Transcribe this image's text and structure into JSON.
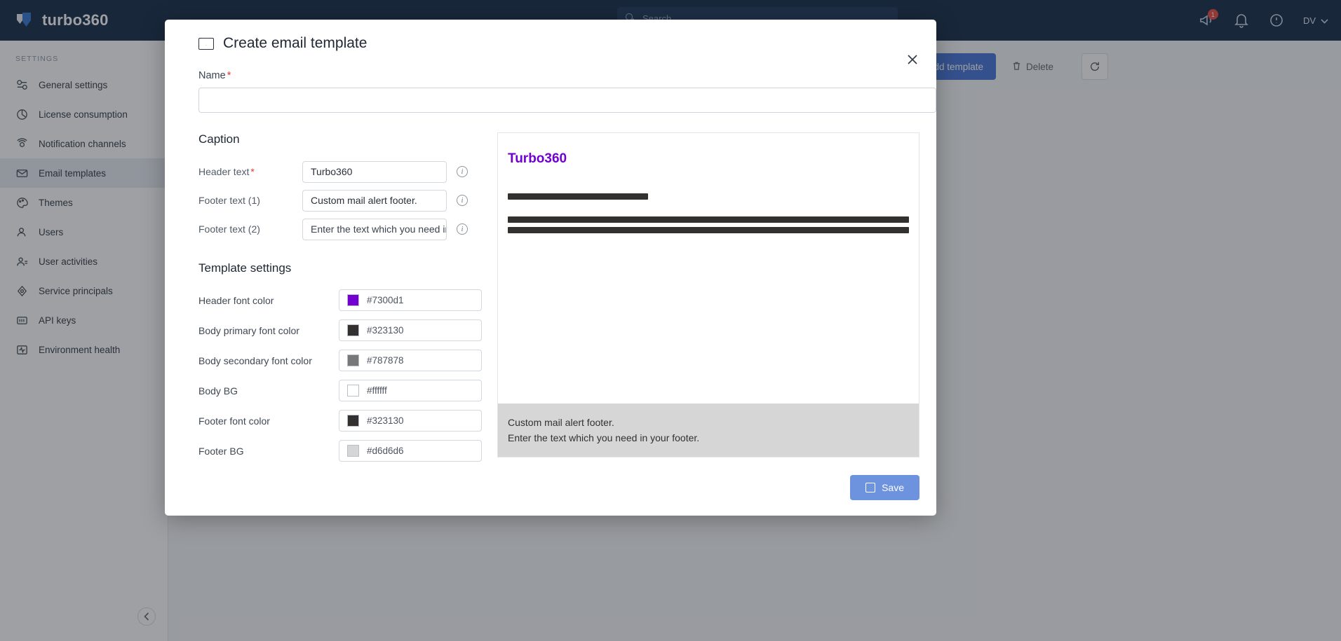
{
  "topbar": {
    "brand": "turbo360",
    "search_placeholder": "Search",
    "search_icon": "search-icon",
    "announcement_icon": "megaphone-icon",
    "announcement_badge": "1",
    "bell_icon": "bell-icon",
    "help_icon": "help-circle-icon",
    "user_initials": "DV",
    "chevron_icon": "chevron-down-icon"
  },
  "sidebar": {
    "section_title": "SETTINGS",
    "items": [
      {
        "label": "General settings",
        "icon": "sliders-icon",
        "active": false
      },
      {
        "label": "License consumption",
        "icon": "pie-chart-icon",
        "active": false
      },
      {
        "label": "Notification channels",
        "icon": "broadcast-icon",
        "active": false
      },
      {
        "label": "Email templates",
        "icon": "envelope-icon",
        "active": true
      },
      {
        "label": "Themes",
        "icon": "palette-icon",
        "active": false
      },
      {
        "label": "Users",
        "icon": "user-icon",
        "active": false
      },
      {
        "label": "User activities",
        "icon": "users-activity-icon",
        "active": false
      },
      {
        "label": "Service principals",
        "icon": "key-node-icon",
        "active": false
      },
      {
        "label": "API keys",
        "icon": "api-key-icon",
        "active": false
      },
      {
        "label": "Environment health",
        "icon": "heartbeat-icon",
        "active": false
      }
    ],
    "collapse_icon": "chevron-left-icon"
  },
  "page_actions": {
    "add_template": "Add template",
    "add_icon": "plus-icon",
    "delete": "Delete",
    "delete_icon": "trash-icon",
    "refresh_icon": "refresh-icon"
  },
  "modal": {
    "title": "Create email template",
    "title_icon": "envelope-icon",
    "close_icon": "close-icon",
    "name_label": "Name",
    "name_required": "*",
    "name_value": "",
    "name_placeholder": "",
    "caption": {
      "heading": "Caption",
      "fields": [
        {
          "label": "Header text",
          "required": "*",
          "value": "Turbo360",
          "info_icon": "info-icon"
        },
        {
          "label": "Footer text (1)",
          "required": "",
          "value": "Custom mail alert footer.",
          "info_icon": "info-icon"
        },
        {
          "label": "Footer text (2)",
          "required": "",
          "value": "Enter the text which you need in your footer.",
          "info_icon": "info-icon"
        }
      ]
    },
    "template_settings": {
      "heading": "Template settings",
      "rows": [
        {
          "label": "Header font color",
          "hex": "#7300d1"
        },
        {
          "label": "Body primary font color",
          "hex": "#323130"
        },
        {
          "label": "Body secondary font color",
          "hex": "#787878"
        },
        {
          "label": "Body BG",
          "hex": "#ffffff"
        },
        {
          "label": "Footer font color",
          "hex": "#323130"
        },
        {
          "label": "Footer BG",
          "hex": "#d6d6d6"
        }
      ]
    },
    "preview": {
      "brand_text": "Turbo360",
      "brand_color": "#7300d1",
      "body_bg": "#ffffff",
      "primary_bar_color": "#323130",
      "secondary_bar_color": "#787878",
      "footer_bg": "#d6d6d6",
      "footer_font_color": "#323130",
      "footer_line_1": "Custom mail alert footer.",
      "footer_line_2": "Enter the text which you need in your footer."
    },
    "save_label": "Save",
    "save_icon": "save-icon"
  }
}
